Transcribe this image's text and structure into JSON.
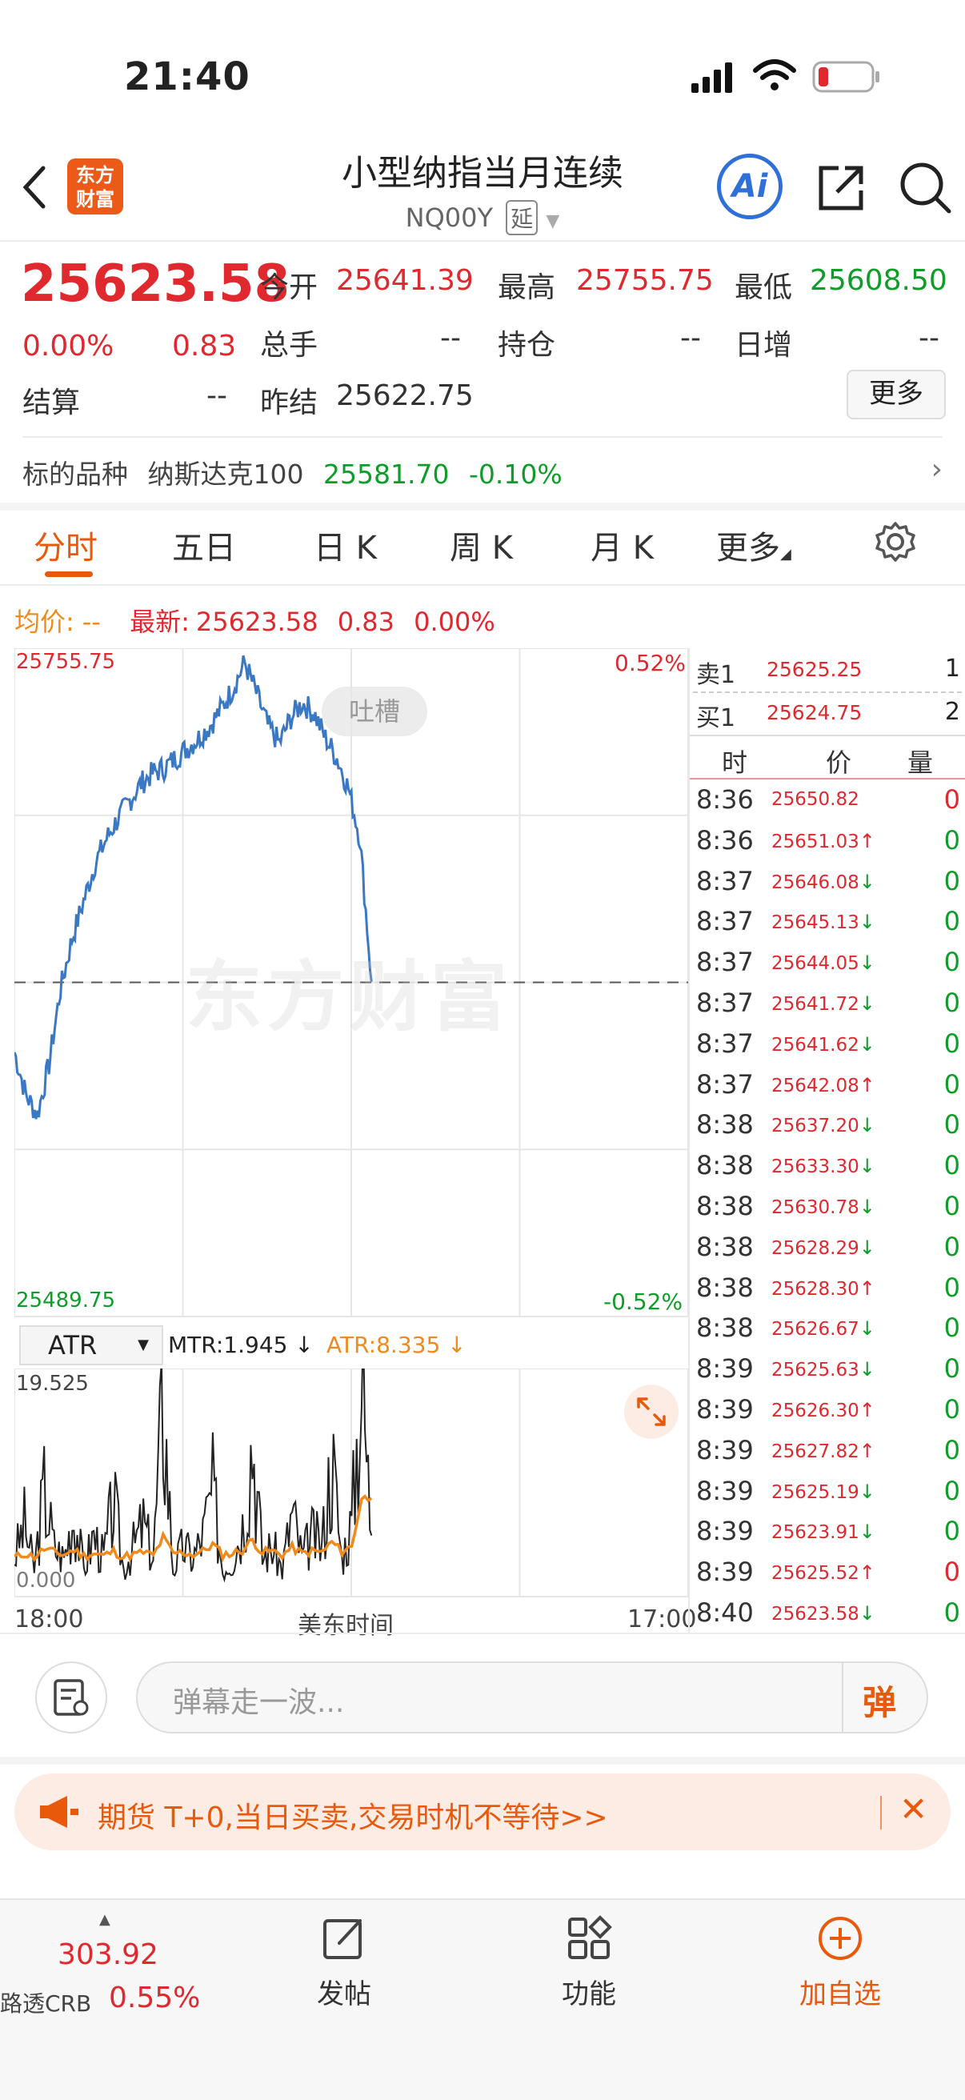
{
  "status_bar": {
    "time": "21:40"
  },
  "nav": {
    "logo_line1": "东方",
    "logo_line2": "财富",
    "title": "小型纳指当月连续",
    "code": "NQ00Y",
    "delay_badge": "延",
    "ai_label": "Ai"
  },
  "quote": {
    "last_price": "25623.58",
    "change_pct": "0.00%",
    "change": "0.83",
    "open_label": "今开",
    "open": "25641.39",
    "high_label": "最高",
    "high": "25755.75",
    "low_label": "最低",
    "low": "25608.50",
    "volume_label": "总手",
    "volume": "--",
    "oi_label": "持仓",
    "oi": "--",
    "daily_inc_label": "日增",
    "daily_inc": "--",
    "settle_label": "结算",
    "settle": "--",
    "prev_settle_label": "昨结",
    "prev_settle": "25622.75",
    "more_button": "更多"
  },
  "underlying": {
    "label": "标的品种",
    "name": "纳斯达克100",
    "price": "25581.70",
    "change": "-0.10%"
  },
  "tabs": [
    {
      "label": "分时",
      "active": true
    },
    {
      "label": "五日"
    },
    {
      "label": "日 K"
    },
    {
      "label": "周 K"
    },
    {
      "label": "月 K"
    },
    {
      "label": "更多"
    }
  ],
  "chart_header": {
    "avg_label": "均价:",
    "avg_value": "--",
    "latest_label": "最新:",
    "latest_value": "25623.58",
    "latest_change": "0.83",
    "latest_pct": "0.00%"
  },
  "chart_data": [
    {
      "type": "line",
      "series": [
        {
          "values": [
            25595,
            25578,
            25570,
            25590,
            25620,
            25640,
            25655,
            25670,
            25680,
            25688,
            25695,
            25702,
            25706,
            25708,
            25712,
            25716,
            25720,
            25725,
            25732,
            25740,
            25750,
            25738,
            25725,
            25718,
            25728,
            25734,
            25730,
            25720,
            25712,
            25700,
            25680,
            25623
          ]
        }
      ],
      "ylim": [
        25489.75,
        25755.75
      ],
      "y_labels": [
        "25755.75",
        "25489.75"
      ],
      "pct_labels": [
        "0.52%",
        "-0.52%"
      ],
      "baseline": 25622.75,
      "x_labels": [
        "18:00",
        "美东时间",
        "17:00"
      ],
      "watermark": "东方财富",
      "badge": "吐槽",
      "colors": {
        "line": "#3a78c4",
        "baseline": "#555555"
      }
    },
    {
      "type": "line",
      "indicator": "ATR",
      "mtr_label": "MTR:1.945 ↓",
      "atr_label": "ATR:8.335 ↓",
      "ylim": [
        0,
        19.525
      ],
      "y_labels": [
        "19.525",
        "0.000"
      ],
      "series": [
        {
          "name": "MTR",
          "values": [
            3,
            6,
            2,
            9,
            4,
            3,
            7,
            2,
            5,
            3,
            8,
            2,
            4,
            6,
            3,
            17,
            2,
            4,
            3,
            5,
            9,
            2,
            3,
            6,
            14,
            3,
            4,
            2,
            7,
            3,
            5,
            4,
            12,
            3,
            6,
            19.5,
            5
          ]
        },
        {
          "name": "ATR",
          "values": [
            3,
            3.4,
            3.1,
            3.8,
            3.5,
            3.3,
            3.7,
            3.2,
            3.4,
            3.2,
            3.6,
            3.1,
            3.3,
            3.5,
            3.2,
            4.8,
            3.4,
            3.5,
            3.3,
            3.6,
            4.2,
            3.3,
            3.4,
            3.7,
            4.6,
            3.5,
            3.6,
            3.3,
            3.9,
            3.4,
            3.6,
            3.5,
            4.4,
            3.6,
            4.0,
            8.3,
            8.3
          ]
        }
      ],
      "colors": {
        "MTR": "#222222",
        "ATR": "#f08a1c"
      }
    }
  ],
  "order_book": {
    "ask_label": "卖1",
    "ask_price": "25625.25",
    "ask_qty": "1",
    "bid_label": "买1",
    "bid_price": "25624.75",
    "bid_qty": "2"
  },
  "trades_header": {
    "time": "时",
    "price": "价",
    "qty": "量"
  },
  "trades": [
    {
      "t": "8:36",
      "p": "25650.82",
      "d": "",
      "q": "0",
      "qc": "red"
    },
    {
      "t": "8:36",
      "p": "25651.03",
      "d": "up",
      "q": "0",
      "qc": "green"
    },
    {
      "t": "8:37",
      "p": "25646.08",
      "d": "down",
      "q": "0",
      "qc": "green"
    },
    {
      "t": "8:37",
      "p": "25645.13",
      "d": "down",
      "q": "0",
      "qc": "green"
    },
    {
      "t": "8:37",
      "p": "25644.05",
      "d": "down",
      "q": "0",
      "qc": "green"
    },
    {
      "t": "8:37",
      "p": "25641.72",
      "d": "down",
      "q": "0",
      "qc": "green"
    },
    {
      "t": "8:37",
      "p": "25641.62",
      "d": "down",
      "q": "0",
      "qc": "green"
    },
    {
      "t": "8:37",
      "p": "25642.08",
      "d": "up",
      "q": "0",
      "qc": "green"
    },
    {
      "t": "8:38",
      "p": "25637.20",
      "d": "down",
      "q": "0",
      "qc": "green"
    },
    {
      "t": "8:38",
      "p": "25633.30",
      "d": "down",
      "q": "0",
      "qc": "green"
    },
    {
      "t": "8:38",
      "p": "25630.78",
      "d": "down",
      "q": "0",
      "qc": "green"
    },
    {
      "t": "8:38",
      "p": "25628.29",
      "d": "down",
      "q": "0",
      "qc": "green"
    },
    {
      "t": "8:38",
      "p": "25628.30",
      "d": "up",
      "q": "0",
      "qc": "green"
    },
    {
      "t": "8:38",
      "p": "25626.67",
      "d": "down",
      "q": "0",
      "qc": "green"
    },
    {
      "t": "8:39",
      "p": "25625.63",
      "d": "down",
      "q": "0",
      "qc": "green"
    },
    {
      "t": "8:39",
      "p": "25626.30",
      "d": "up",
      "q": "0",
      "qc": "green"
    },
    {
      "t": "8:39",
      "p": "25627.82",
      "d": "up",
      "q": "0",
      "qc": "green"
    },
    {
      "t": "8:39",
      "p": "25625.19",
      "d": "down",
      "q": "0",
      "qc": "green"
    },
    {
      "t": "8:39",
      "p": "25623.91",
      "d": "down",
      "q": "0",
      "qc": "green"
    },
    {
      "t": "8:39",
      "p": "25625.52",
      "d": "up",
      "q": "0",
      "qc": "red"
    },
    {
      "t": "8:40",
      "p": "25623.58",
      "d": "down",
      "q": "0",
      "qc": "green"
    }
  ],
  "comment_bar": {
    "placeholder": "弹幕走一波...",
    "danmaku_button": "弹"
  },
  "promo": {
    "text": "期货 T+0,当日买卖,交易时机不等待>>"
  },
  "bottom_nav": {
    "index_value": "303.92",
    "index_name": "路透CRB",
    "index_pct": "0.55%",
    "post": "发帖",
    "functions": "功能",
    "add_watch": "加自选"
  },
  "colors": {
    "up": "#e0282f",
    "down": "#0f9d2a",
    "accent": "#e8590c",
    "line": "#3a78c4"
  }
}
